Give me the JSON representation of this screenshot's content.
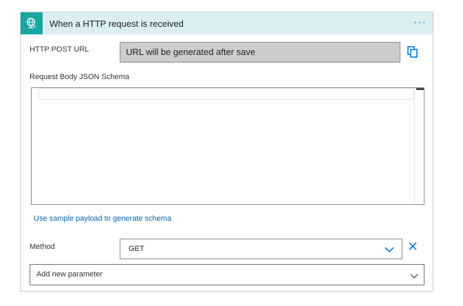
{
  "header": {
    "title": "When a HTTP request is received",
    "more_label": "···",
    "icon": "http-request-trigger-icon"
  },
  "url_field": {
    "label": "HTTP POST URL",
    "value": "URL will be generated after save",
    "copy_icon": "copy-icon"
  },
  "schema": {
    "label": "Request Body JSON Schema",
    "content": "",
    "sample_link": "Use sample payload to generate schema"
  },
  "method": {
    "label": "Method",
    "value": "GET",
    "clear_icon": "close-icon"
  },
  "parameters": {
    "placeholder": "Add new parameter"
  },
  "colors": {
    "header_bg": "#dbeef1",
    "icon_bg": "#1aa6a0",
    "accent": "#0078d4",
    "link": "#0a5ea8"
  }
}
